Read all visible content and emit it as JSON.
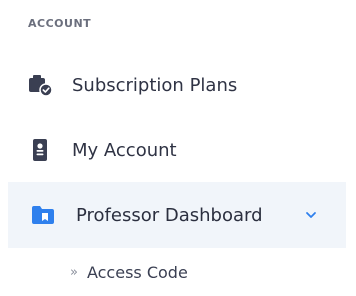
{
  "sidebar": {
    "section_label": "ACCOUNT",
    "items": [
      {
        "label": "Subscription Plans",
        "icon": "subscription-icon"
      },
      {
        "label": "My Account",
        "icon": "id-card-icon"
      },
      {
        "label": "Professor Dashboard",
        "icon": "folder-icon",
        "expanded": true
      }
    ],
    "subitems": [
      {
        "marker": "»",
        "label": "Access Code"
      }
    ]
  },
  "colors": {
    "accent": "#2f80ed",
    "active_background": "#f1f5fa",
    "icon_dark": "#3a3f52"
  }
}
